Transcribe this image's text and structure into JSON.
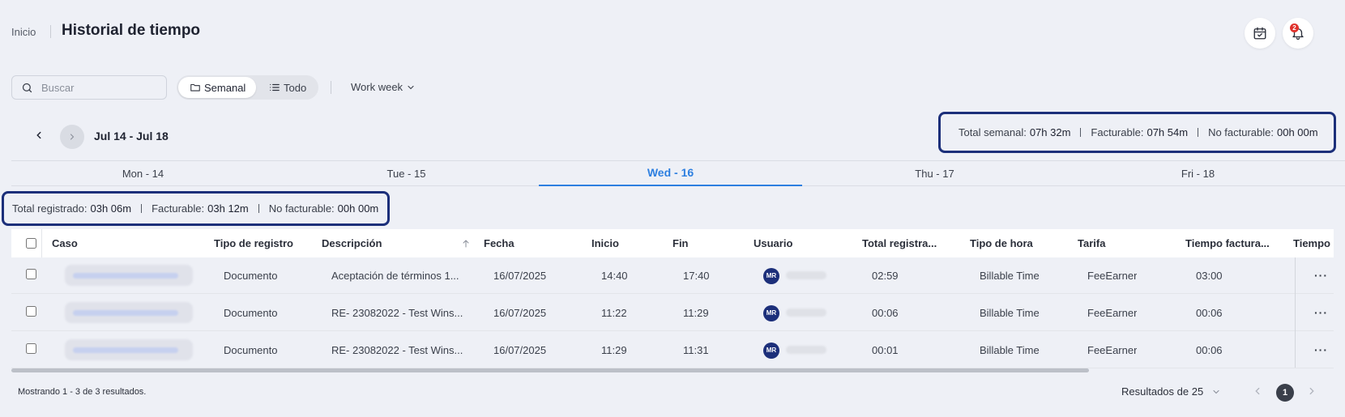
{
  "header": {
    "breadcrumb": "Inicio",
    "title": "Historial de tiempo",
    "notification_count": "2"
  },
  "toolbar": {
    "search_placeholder": "Buscar",
    "view_weekly": "Semanal",
    "view_all": "Todo",
    "period": "Work week"
  },
  "week": {
    "range": "Jul 14 - Jul 18",
    "summary": {
      "total_label": "Total semanal:",
      "total_value": "07h 32m",
      "billable_label": "Facturable:",
      "billable_value": "07h 54m",
      "nonbillable_label": "No facturable:",
      "nonbillable_value": "00h 00m"
    }
  },
  "days": [
    {
      "label": "Mon - 14"
    },
    {
      "label": "Tue - 15"
    },
    {
      "label": "Wed - 16"
    },
    {
      "label": "Thu - 17"
    },
    {
      "label": "Fri - 18"
    }
  ],
  "active_day": "Wed - 16",
  "day_summary": {
    "total_label": "Total registrado:",
    "total_value": "03h 06m",
    "billable_label": "Facturable:",
    "billable_value": "03h 12m",
    "nonbillable_label": "No facturable:",
    "nonbillable_value": "00h 00m"
  },
  "table": {
    "columns": [
      "Caso",
      "Tipo de registro",
      "Descripción",
      "Fecha",
      "Inicio",
      "Fin",
      "Usuario",
      "Total registra...",
      "Tipo de hora",
      "Tarifa",
      "Tiempo factura...",
      "Tiempo"
    ],
    "rows": [
      {
        "tipo": "Documento",
        "descripcion": "Aceptación de términos 1...",
        "fecha": "16/07/2025",
        "inicio": "14:40",
        "fin": "17:40",
        "initials": "MR",
        "total": "02:59",
        "tipo_hora": "Billable Time",
        "tarifa": "FeeEarner",
        "facturado": "03:00"
      },
      {
        "tipo": "Documento",
        "descripcion": "RE- 23082022 - Test Wins...",
        "fecha": "16/07/2025",
        "inicio": "11:22",
        "fin": "11:29",
        "initials": "MR",
        "total": "00:06",
        "tipo_hora": "Billable Time",
        "tarifa": "FeeEarner",
        "facturado": "00:06"
      },
      {
        "tipo": "Documento",
        "descripcion": "RE- 23082022 - Test Wins...",
        "fecha": "16/07/2025",
        "inicio": "11:29",
        "fin": "11:31",
        "initials": "MR",
        "total": "00:01",
        "tipo_hora": "Billable Time",
        "tarifa": "FeeEarner",
        "facturado": "00:06"
      }
    ]
  },
  "footer": {
    "showing": "Mostrando 1 - 3 de 3 resultados.",
    "per_page": "Resultados de 25",
    "current_page": "1"
  }
}
